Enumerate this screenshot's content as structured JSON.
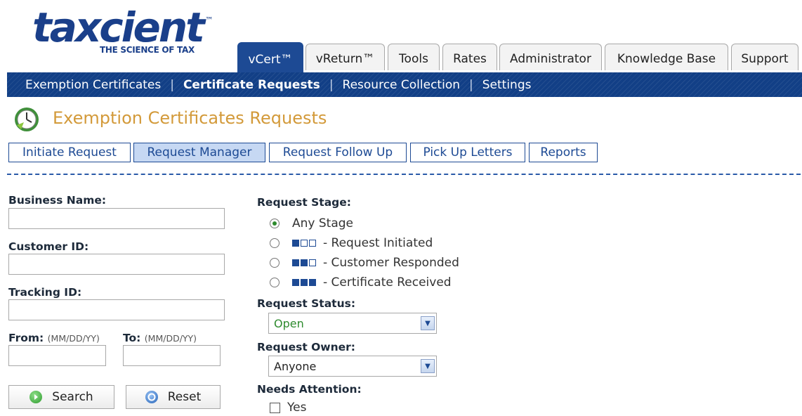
{
  "logo": {
    "word": "taxcient",
    "tm": "™",
    "tagline": "THE SCIENCE OF TAX"
  },
  "main_tabs": [
    "vCert™",
    "vReturn™",
    "Tools",
    "Rates",
    "Administrator",
    "Knowledge Base",
    "Support"
  ],
  "sub_nav": [
    "Exemption Certificates",
    "Certificate Requests",
    "Resource Collection",
    "Settings"
  ],
  "page_title": "Exemption Certificates Requests",
  "sub_tabs": [
    "Initiate Request",
    "Request Manager",
    "Request Follow Up",
    "Pick Up Letters",
    "Reports"
  ],
  "form": {
    "business_name_label": "Business Name:",
    "customer_id_label": "Customer ID:",
    "tracking_id_label": "Tracking ID:",
    "from_label": "From:",
    "from_hint": "(MM/DD/YY)",
    "to_label": "To:",
    "to_hint": "(MM/DD/YY)",
    "search_label": "Search",
    "reset_label": "Reset"
  },
  "request_stage": {
    "label": "Request Stage:",
    "options": [
      "Any Stage",
      "- Request Initiated",
      "- Customer Responded",
      "- Certificate Received"
    ]
  },
  "request_status": {
    "label": "Request Status:",
    "value": "Open"
  },
  "request_owner": {
    "label": "Request Owner:",
    "value": "Anyone"
  },
  "needs_attention": {
    "label": "Needs Attention:",
    "option": "Yes"
  },
  "colors": {
    "brand": "#1d4a94",
    "title": "#d39a3a",
    "status_value": "#2e8b2e"
  }
}
